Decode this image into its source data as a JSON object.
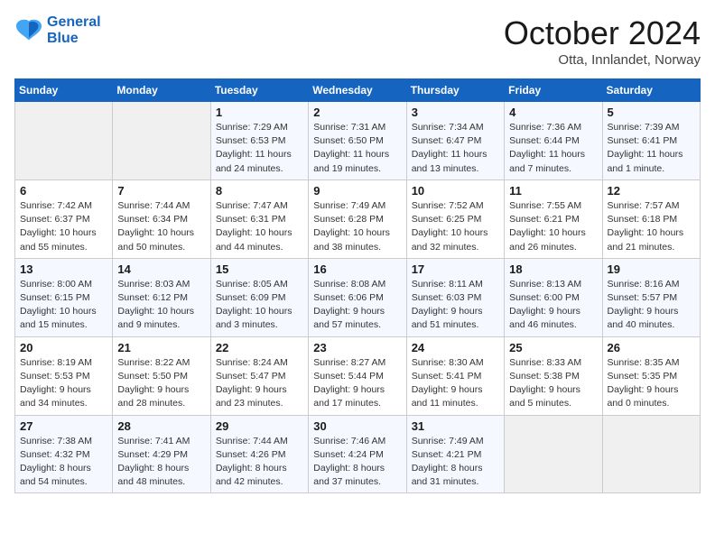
{
  "header": {
    "logo_line1": "General",
    "logo_line2": "Blue",
    "month": "October 2024",
    "location": "Otta, Innlandet, Norway"
  },
  "weekdays": [
    "Sunday",
    "Monday",
    "Tuesday",
    "Wednesday",
    "Thursday",
    "Friday",
    "Saturday"
  ],
  "weeks": [
    [
      null,
      null,
      {
        "day": 1,
        "sunrise": "7:29 AM",
        "sunset": "6:53 PM",
        "daylight": "11 hours and 24 minutes."
      },
      {
        "day": 2,
        "sunrise": "7:31 AM",
        "sunset": "6:50 PM",
        "daylight": "11 hours and 19 minutes."
      },
      {
        "day": 3,
        "sunrise": "7:34 AM",
        "sunset": "6:47 PM",
        "daylight": "11 hours and 13 minutes."
      },
      {
        "day": 4,
        "sunrise": "7:36 AM",
        "sunset": "6:44 PM",
        "daylight": "11 hours and 7 minutes."
      },
      {
        "day": 5,
        "sunrise": "7:39 AM",
        "sunset": "6:41 PM",
        "daylight": "11 hours and 1 minute."
      }
    ],
    [
      {
        "day": 6,
        "sunrise": "7:42 AM",
        "sunset": "6:37 PM",
        "daylight": "10 hours and 55 minutes."
      },
      {
        "day": 7,
        "sunrise": "7:44 AM",
        "sunset": "6:34 PM",
        "daylight": "10 hours and 50 minutes."
      },
      {
        "day": 8,
        "sunrise": "7:47 AM",
        "sunset": "6:31 PM",
        "daylight": "10 hours and 44 minutes."
      },
      {
        "day": 9,
        "sunrise": "7:49 AM",
        "sunset": "6:28 PM",
        "daylight": "10 hours and 38 minutes."
      },
      {
        "day": 10,
        "sunrise": "7:52 AM",
        "sunset": "6:25 PM",
        "daylight": "10 hours and 32 minutes."
      },
      {
        "day": 11,
        "sunrise": "7:55 AM",
        "sunset": "6:21 PM",
        "daylight": "10 hours and 26 minutes."
      },
      {
        "day": 12,
        "sunrise": "7:57 AM",
        "sunset": "6:18 PM",
        "daylight": "10 hours and 21 minutes."
      }
    ],
    [
      {
        "day": 13,
        "sunrise": "8:00 AM",
        "sunset": "6:15 PM",
        "daylight": "10 hours and 15 minutes."
      },
      {
        "day": 14,
        "sunrise": "8:03 AM",
        "sunset": "6:12 PM",
        "daylight": "10 hours and 9 minutes."
      },
      {
        "day": 15,
        "sunrise": "8:05 AM",
        "sunset": "6:09 PM",
        "daylight": "10 hours and 3 minutes."
      },
      {
        "day": 16,
        "sunrise": "8:08 AM",
        "sunset": "6:06 PM",
        "daylight": "9 hours and 57 minutes."
      },
      {
        "day": 17,
        "sunrise": "8:11 AM",
        "sunset": "6:03 PM",
        "daylight": "9 hours and 51 minutes."
      },
      {
        "day": 18,
        "sunrise": "8:13 AM",
        "sunset": "6:00 PM",
        "daylight": "9 hours and 46 minutes."
      },
      {
        "day": 19,
        "sunrise": "8:16 AM",
        "sunset": "5:57 PM",
        "daylight": "9 hours and 40 minutes."
      }
    ],
    [
      {
        "day": 20,
        "sunrise": "8:19 AM",
        "sunset": "5:53 PM",
        "daylight": "9 hours and 34 minutes."
      },
      {
        "day": 21,
        "sunrise": "8:22 AM",
        "sunset": "5:50 PM",
        "daylight": "9 hours and 28 minutes."
      },
      {
        "day": 22,
        "sunrise": "8:24 AM",
        "sunset": "5:47 PM",
        "daylight": "9 hours and 23 minutes."
      },
      {
        "day": 23,
        "sunrise": "8:27 AM",
        "sunset": "5:44 PM",
        "daylight": "9 hours and 17 minutes."
      },
      {
        "day": 24,
        "sunrise": "8:30 AM",
        "sunset": "5:41 PM",
        "daylight": "9 hours and 11 minutes."
      },
      {
        "day": 25,
        "sunrise": "8:33 AM",
        "sunset": "5:38 PM",
        "daylight": "9 hours and 5 minutes."
      },
      {
        "day": 26,
        "sunrise": "8:35 AM",
        "sunset": "5:35 PM",
        "daylight": "9 hours and 0 minutes."
      }
    ],
    [
      {
        "day": 27,
        "sunrise": "7:38 AM",
        "sunset": "4:32 PM",
        "daylight": "8 hours and 54 minutes."
      },
      {
        "day": 28,
        "sunrise": "7:41 AM",
        "sunset": "4:29 PM",
        "daylight": "8 hours and 48 minutes."
      },
      {
        "day": 29,
        "sunrise": "7:44 AM",
        "sunset": "4:26 PM",
        "daylight": "8 hours and 42 minutes."
      },
      {
        "day": 30,
        "sunrise": "7:46 AM",
        "sunset": "4:24 PM",
        "daylight": "8 hours and 37 minutes."
      },
      {
        "day": 31,
        "sunrise": "7:49 AM",
        "sunset": "4:21 PM",
        "daylight": "8 hours and 31 minutes."
      },
      null,
      null
    ]
  ]
}
